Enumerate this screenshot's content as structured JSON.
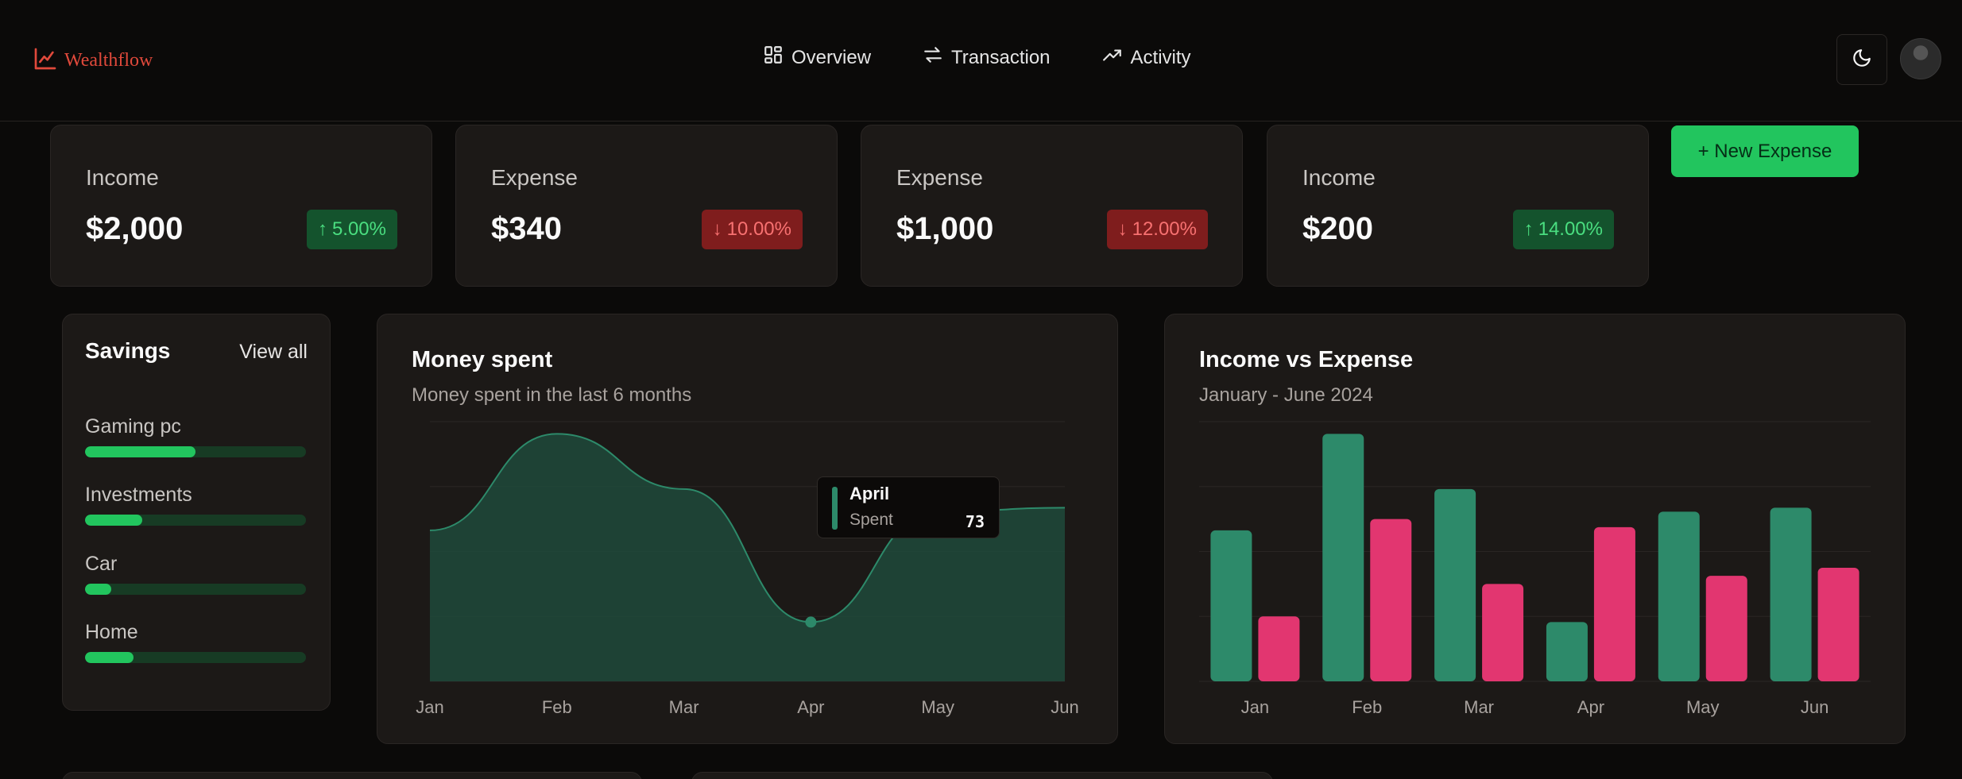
{
  "app": {
    "name": "Wealthflow"
  },
  "nav": [
    {
      "label": "Overview",
      "icon": "grid-icon"
    },
    {
      "label": "Transaction",
      "icon": "arrows-exchange-icon"
    },
    {
      "label": "Activity",
      "icon": "trending-up-icon"
    }
  ],
  "stats": [
    {
      "label": "Income",
      "value": "$2,000",
      "change": "5.00%",
      "direction": "up"
    },
    {
      "label": "Expense",
      "value": "$340",
      "change": "10.00%",
      "direction": "down"
    },
    {
      "label": "Expense",
      "value": "$1,000",
      "change": "12.00%",
      "direction": "down"
    },
    {
      "label": "Income",
      "value": "$200",
      "change": "14.00%",
      "direction": "up"
    }
  ],
  "actions": {
    "new_expense": "+ New Expense"
  },
  "savings": {
    "title": "Savings",
    "view_all": "View all",
    "items": [
      {
        "label": "Gaming pc",
        "progress": 0.5
      },
      {
        "label": "Investments",
        "progress": 0.26
      },
      {
        "label": "Car",
        "progress": 0.12
      },
      {
        "label": "Home",
        "progress": 0.22
      }
    ]
  },
  "money_spent": {
    "title": "Money spent",
    "subtitle": "Money spent in the last 6 months",
    "tooltip": {
      "month": "April",
      "key": "Spent",
      "value": "73"
    }
  },
  "income_vs_expense": {
    "title": "Income vs Expense",
    "subtitle": "January - June 2024"
  },
  "colors": {
    "brand": "#e0493b",
    "accent": "#22c55e",
    "series_green": "#2d8a6a",
    "series_pink": "#e23670",
    "up": "#4ade80",
    "down": "#f87171"
  },
  "chart_data": [
    {
      "type": "area",
      "title": "Money spent",
      "subtitle": "Money spent in the last 6 months",
      "categories": [
        "Jan",
        "Feb",
        "Mar",
        "Apr",
        "May",
        "Jun"
      ],
      "series": [
        {
          "name": "Spent",
          "values": [
            186,
            305,
            237,
            73,
            209,
            214
          ]
        }
      ],
      "ylim": [
        0,
        320
      ],
      "grid": true
    },
    {
      "type": "bar",
      "title": "Income vs Expense",
      "subtitle": "January - June 2024",
      "categories": [
        "Jan",
        "Feb",
        "Mar",
        "Apr",
        "May",
        "Jun"
      ],
      "series": [
        {
          "values": [
            186,
            305,
            237,
            73,
            209,
            214
          ]
        },
        {
          "values": [
            80,
            200,
            120,
            190,
            130,
            140
          ]
        }
      ],
      "ylim": [
        0,
        320
      ],
      "grid": true
    }
  ]
}
